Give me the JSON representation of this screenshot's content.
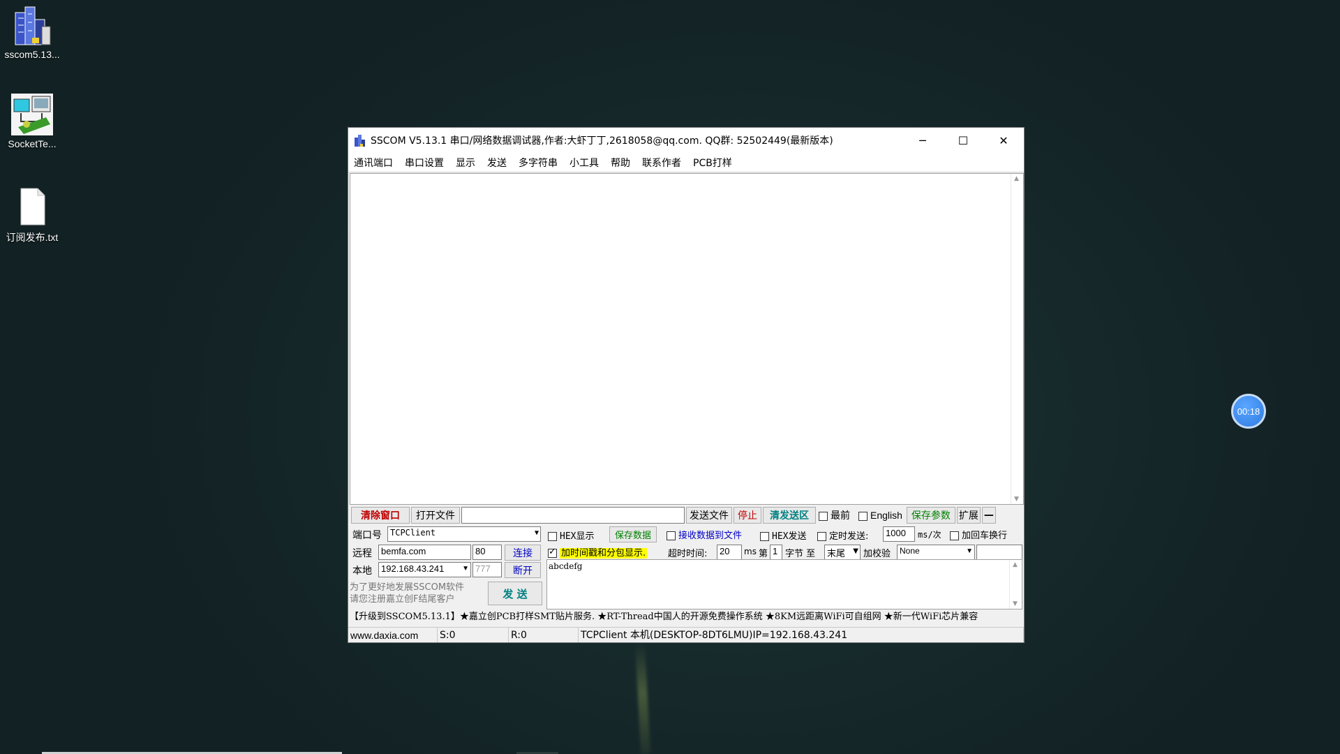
{
  "desktop": {
    "icons": [
      {
        "label": "sscom5.13...",
        "icon": "building-app-icon"
      },
      {
        "label": "SocketTe...",
        "icon": "network-tool-icon"
      },
      {
        "label": "订阅发布.txt",
        "icon": "text-file-icon"
      }
    ],
    "recorder_time": "00:18"
  },
  "window": {
    "title": "SSCOM V5.13.1 串口/网络数据调试器,作者:大虾丁丁,2618058@qq.com. QQ群: 52502449(最新版本)",
    "menu": [
      "通讯端口",
      "串口设置",
      "显示",
      "发送",
      "多字符串",
      "小工具",
      "帮助",
      "联系作者",
      "PCB打样"
    ],
    "toolbar": {
      "clear": "清除窗口",
      "open_file": "打开文件",
      "send_file": "发送文件",
      "stop": "停止",
      "clear_send": "清发送区",
      "topmost": "最前",
      "english": "English",
      "save_params": "保存参数",
      "expand": "扩展",
      "collapse": "—"
    },
    "left": {
      "port_label": "端口号",
      "port_value": "TCPClient",
      "remote_label": "远程",
      "remote_host": "bemfa.com",
      "remote_port": "80",
      "connect": "连接",
      "local_label": "本地",
      "local_ip": "192.168.43.241",
      "local_port": "777",
      "disconnect": "断开",
      "promo_line1": "为了更好地发展SSCOM软件",
      "promo_line2": "请您注册嘉立创F结尾客户",
      "send": "发 送"
    },
    "options": {
      "hex_display": "HEX显示",
      "save_data": "保存数据",
      "recv_to_file": "接收数据到文件",
      "hex_send": "HEX发送",
      "timed_send": "定时发送:",
      "interval": "1000",
      "interval_unit": "ms/次",
      "add_crlf": "加回车换行",
      "timestamp": "加时间戳和分包显示.",
      "timeout_label": "超时时间:",
      "timeout": "20",
      "timeout_unit": "ms",
      "nth_label": "第",
      "nth": "1",
      "byte_label": "字节 至",
      "end_value": "末尾",
      "checksum_label": "加校验",
      "checksum_value": "None"
    },
    "send_text": "abcdefg",
    "ticker": "【升级到SSCOM5.13.1】★嘉立创PCB打样SMT贴片服务. ★RT-Thread中国人的开源免费操作系统 ★8KM远距离WiFi可自组网 ★新一代WiFi芯片兼容",
    "status": {
      "url": "www.daxia.com",
      "sent": "S:0",
      "recv": "R:0",
      "info": "TCPClient 本机(DESKTOP-8DT6LMU)IP=192.168.43.241"
    }
  }
}
